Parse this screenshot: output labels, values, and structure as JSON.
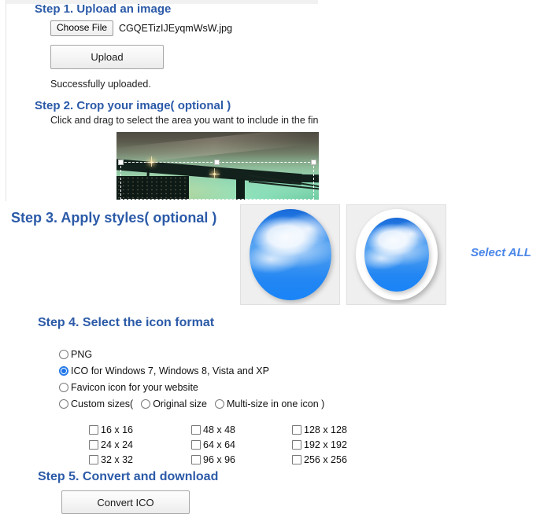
{
  "step1": {
    "heading": "Step 1. Upload an image",
    "choose_file_label": "Choose File",
    "file_name": "CGQETizIJEyqmWsW.jpg",
    "upload_label": "Upload",
    "status": "Successfully uploaded."
  },
  "step2": {
    "heading": "Step 2. Crop your image( optional )",
    "description": "Click and drag to select the area you want to include in the final ic"
  },
  "step3": {
    "heading": "Step 3. Apply styles( optional )",
    "select_all_label": "Select ALL"
  },
  "step4": {
    "heading": "Step 4. Select the icon format",
    "options": [
      {
        "label": "PNG",
        "checked": false
      },
      {
        "label": "ICO for Windows 7, Windows 8, Vista and XP",
        "checked": true
      },
      {
        "label": "Favicon icon for your website",
        "checked": false
      }
    ],
    "custom_prefix": "Custom sizes(",
    "custom_inline": [
      {
        "label": "Original size",
        "checked": false
      },
      {
        "label": "Multi-size in one icon )",
        "checked": false
      }
    ],
    "sizes": [
      {
        "label": "16 x 16",
        "checked": false
      },
      {
        "label": "48 x 48",
        "checked": false
      },
      {
        "label": "128 x 128",
        "checked": false
      },
      {
        "label": "24 x 24",
        "checked": false
      },
      {
        "label": "64 x 64",
        "checked": false
      },
      {
        "label": "192 x 192",
        "checked": false
      },
      {
        "label": "32 x 32",
        "checked": false
      },
      {
        "label": "96 x 96",
        "checked": false
      },
      {
        "label": "256 x 256",
        "checked": false
      }
    ]
  },
  "step5": {
    "heading": "Step 5. Convert and download",
    "convert_label": "Convert ICO"
  },
  "colors": {
    "heading_blue": "#2b5aa8",
    "accent_blue": "#4a86e8",
    "radio_selected": "#1a73e8"
  }
}
